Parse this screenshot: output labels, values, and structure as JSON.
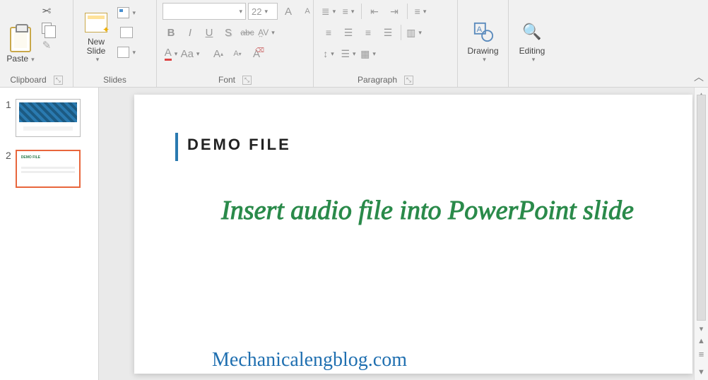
{
  "ribbon": {
    "clipboard": {
      "label": "Clipboard",
      "paste": "Paste"
    },
    "slides": {
      "label": "Slides",
      "newslide": "New\nSlide"
    },
    "font": {
      "label": "Font",
      "size_value": "22",
      "bold": "B",
      "italic": "I",
      "underline": "U",
      "shadow": "S",
      "strike": "abc",
      "spacing": "AV",
      "fontcolor": "A",
      "case": "Aa",
      "clear": "A",
      "grow": "A",
      "shrink": "A"
    },
    "paragraph": {
      "label": "Paragraph"
    },
    "drawing": {
      "label": "Drawing"
    },
    "editing": {
      "label": "Editing"
    }
  },
  "thumbnails": {
    "slide1_num": "1",
    "slide2_num": "2"
  },
  "slide": {
    "title": "DEMO FILE",
    "body": "Insert audio file into PowerPoint slide"
  },
  "watermark": "Mechanicalengblog.com"
}
